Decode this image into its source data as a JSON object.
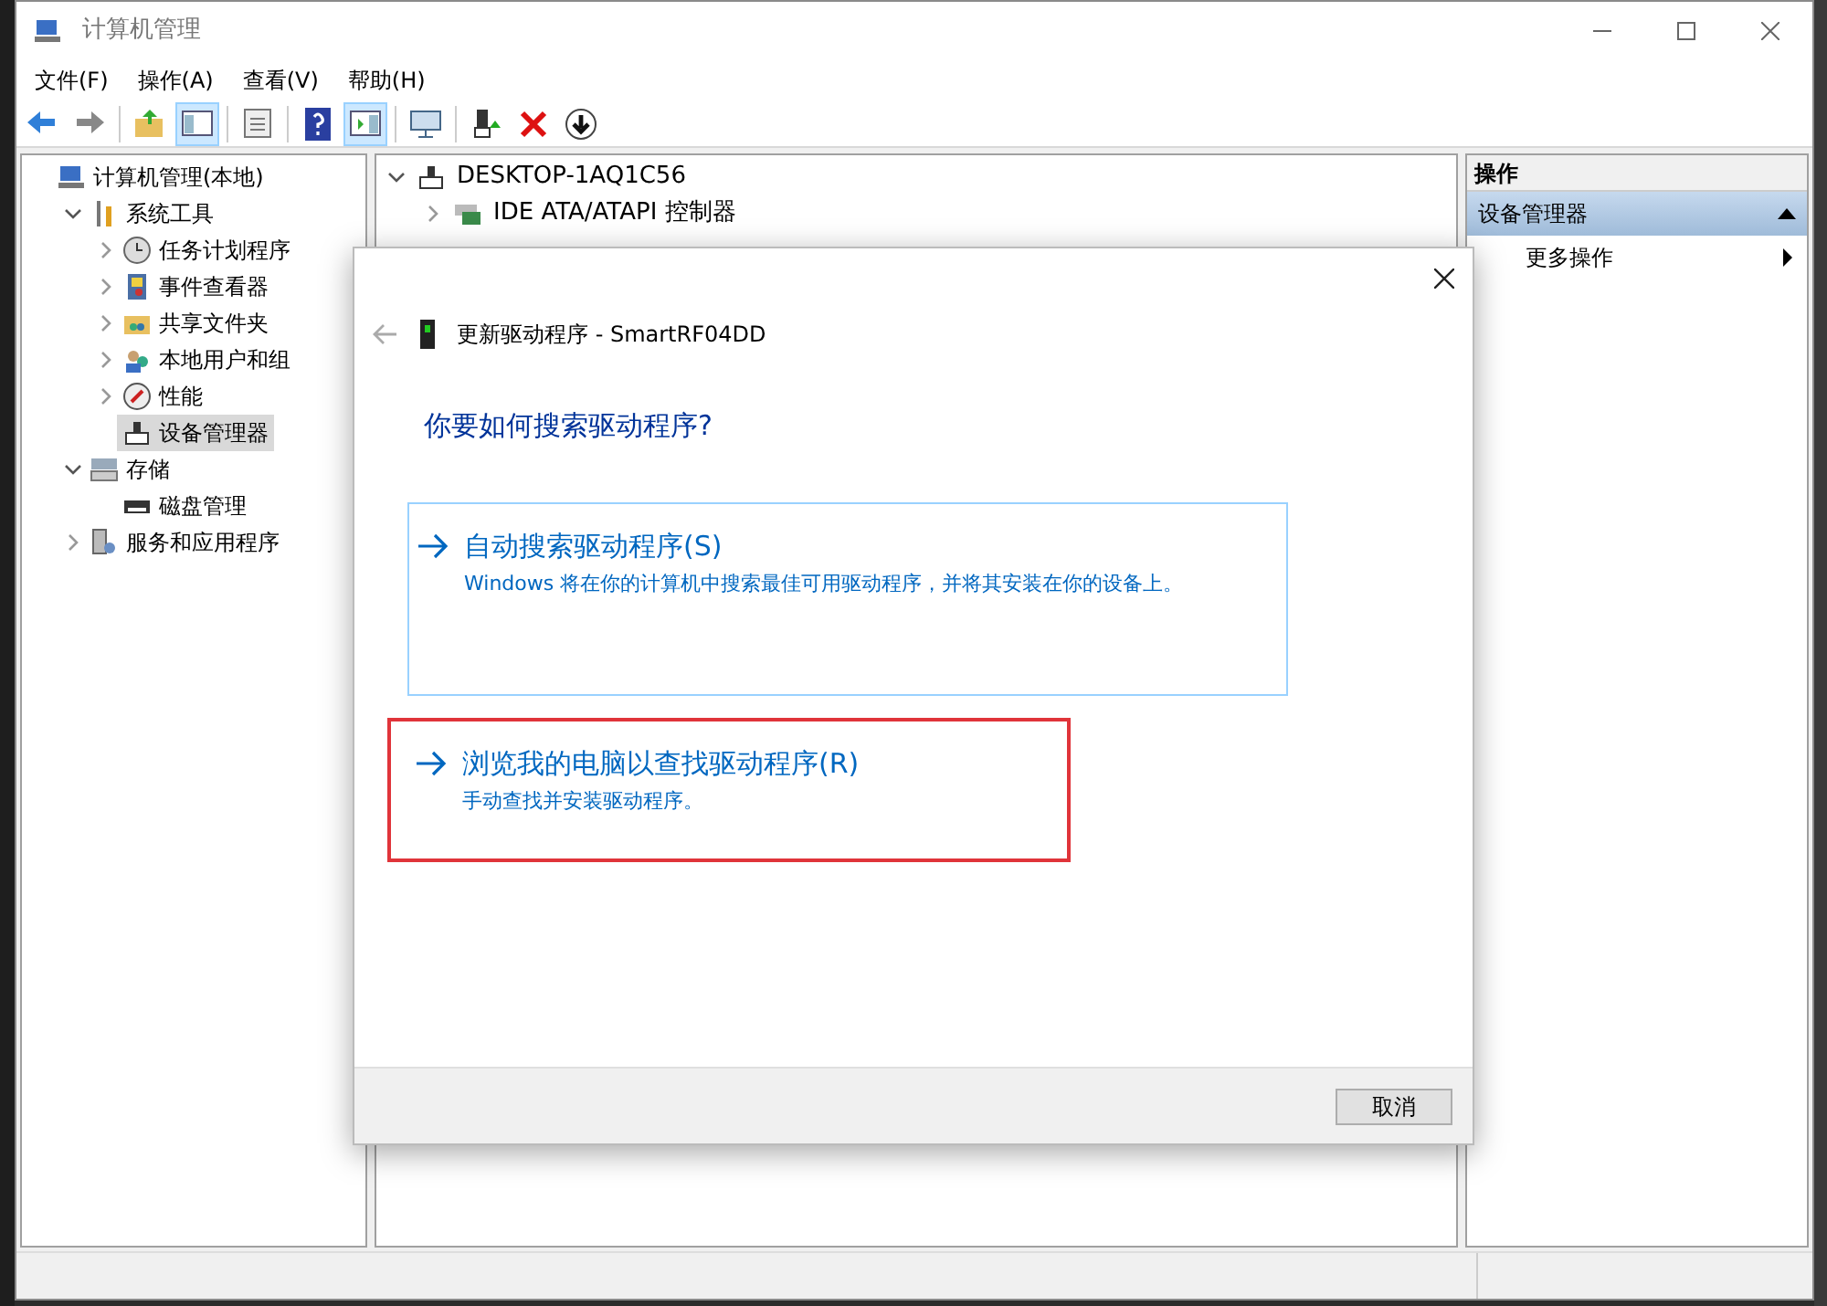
{
  "window": {
    "title": "计算机管理"
  },
  "menu": [
    "文件(F)",
    "操作(A)",
    "查看(V)",
    "帮助(H)"
  ],
  "toolbar": [
    {
      "kind": "back",
      "pressed": false
    },
    {
      "kind": "forward",
      "pressed": false
    },
    {
      "kind": "sep"
    },
    {
      "kind": "up",
      "pressed": false
    },
    {
      "kind": "tree",
      "pressed": true
    },
    {
      "kind": "sep"
    },
    {
      "kind": "props",
      "pressed": false
    },
    {
      "kind": "sep"
    },
    {
      "kind": "help",
      "pressed": false
    },
    {
      "kind": "pane",
      "pressed": true
    },
    {
      "kind": "sep"
    },
    {
      "kind": "scan",
      "pressed": false
    },
    {
      "kind": "sep"
    },
    {
      "kind": "update",
      "pressed": false
    },
    {
      "kind": "remove",
      "pressed": false
    },
    {
      "kind": "disable",
      "pressed": false
    }
  ],
  "nav_tree": [
    {
      "label": "计算机管理(本地)",
      "kind": "computer",
      "selected": false,
      "children": [
        {
          "label": "系统工具",
          "kind": "tools",
          "expanded": true,
          "selected": false,
          "children": [
            {
              "label": "任务计划程序",
              "kind": "clock",
              "expanded": false,
              "selected": false
            },
            {
              "label": "事件查看器",
              "kind": "log",
              "expanded": false,
              "selected": false
            },
            {
              "label": "共享文件夹",
              "kind": "share",
              "expanded": false,
              "selected": false
            },
            {
              "label": "本地用户和组",
              "kind": "users",
              "expanded": false,
              "selected": false
            },
            {
              "label": "性能",
              "kind": "gauge",
              "expanded": false,
              "selected": false
            },
            {
              "label": "设备管理器",
              "kind": "device",
              "selected": true
            }
          ]
        },
        {
          "label": "存储",
          "kind": "storage",
          "expanded": true,
          "selected": false,
          "children": [
            {
              "label": "磁盘管理",
              "kind": "disk",
              "selected": false
            }
          ]
        },
        {
          "label": "服务和应用程序",
          "kind": "services",
          "expanded": false,
          "selected": false
        }
      ]
    }
  ],
  "device_tree": {
    "label": "DESKTOP-1AQ1C56",
    "expanded": true,
    "children": [
      {
        "label": "IDE ATA/ATAPI 控制器",
        "kind": "ide",
        "expanded": false
      }
    ]
  },
  "actions": {
    "header": "操作",
    "section": "设备管理器",
    "expanded": true,
    "items": [
      {
        "label": "更多操作",
        "submenu": true
      }
    ]
  },
  "dialog": {
    "title": "更新驱动程序 - SmartRF04DD",
    "question": "你要如何搜索驱动程序?",
    "options": [
      {
        "title": "自动搜索驱动程序(S)",
        "description": "Windows 将在你的计算机中搜索最佳可用驱动程序，并将其安装在你的设备上。",
        "highlighted": false
      },
      {
        "title": "浏览我的电脑以查找驱动程序(R)",
        "description": "手动查找并安装驱动程序。",
        "highlighted": true
      }
    ],
    "cancel": "取消"
  }
}
